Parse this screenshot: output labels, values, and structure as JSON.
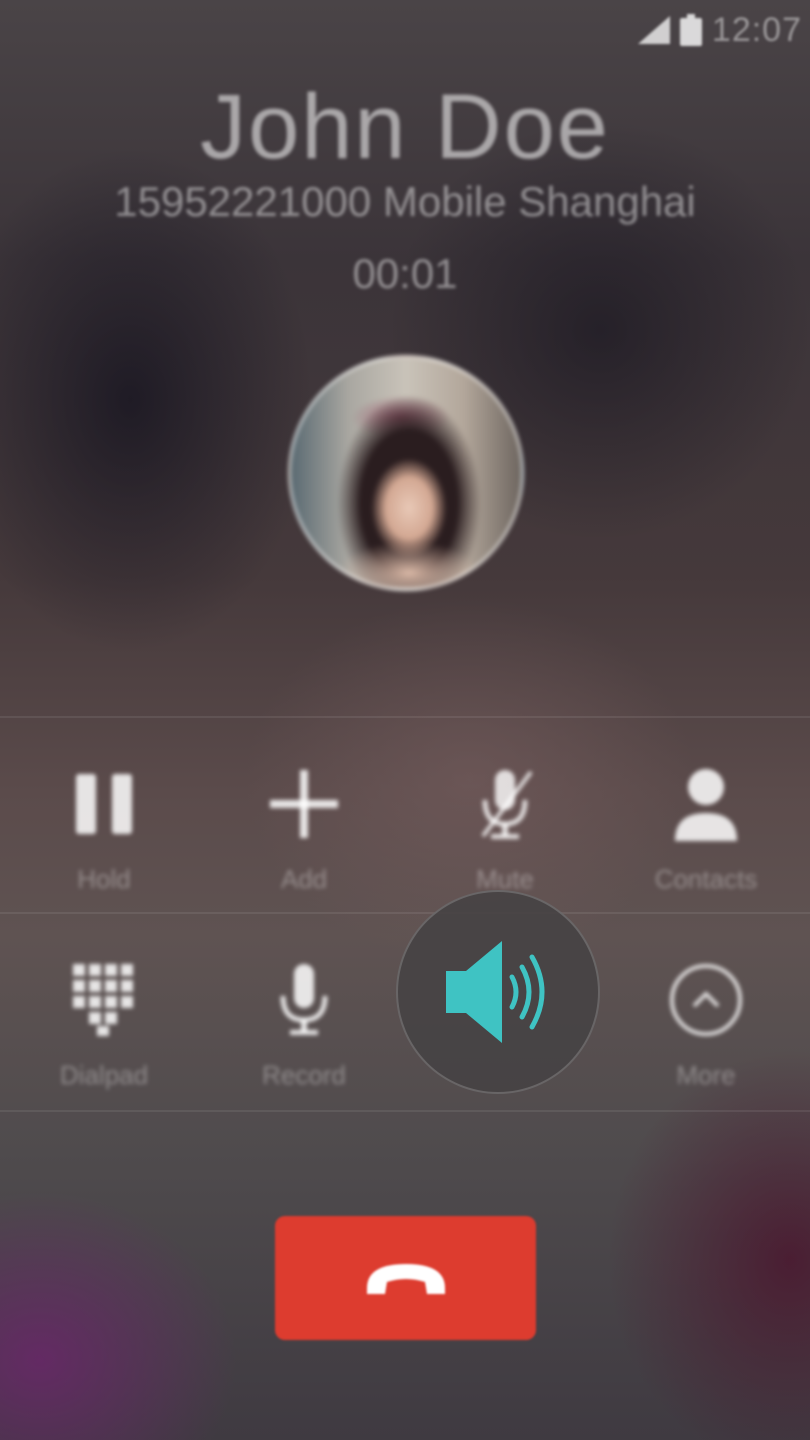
{
  "status_bar": {
    "time": "12:07",
    "signal_icon": "cellular-signal-icon",
    "battery_icon": "battery-icon"
  },
  "call": {
    "caller_name": "John Doe",
    "caller_info": "15952221000 Mobile Shanghai",
    "duration": "00:01",
    "avatar_icon": "caller-photo"
  },
  "controls_row1": [
    {
      "label": "Hold",
      "icon": "pause-icon"
    },
    {
      "label": "Add",
      "icon": "plus-icon"
    },
    {
      "label": "Mute",
      "icon": "mic-muted-icon"
    },
    {
      "label": "Contacts",
      "icon": "contact-person-icon"
    }
  ],
  "controls_row2": [
    {
      "label": "Dialpad",
      "icon": "dialpad-icon"
    },
    {
      "label": "Record",
      "icon": "microphone-icon"
    },
    {
      "label": "",
      "icon": "speaker-icon",
      "active": true
    },
    {
      "label": "More",
      "icon": "chevron-up-circle-icon"
    }
  ],
  "end_call": {
    "icon": "hang-up-icon"
  },
  "colors": {
    "accent": "#3fc3c3",
    "end_call": "#dd3c2f",
    "text": "#ffffff"
  }
}
